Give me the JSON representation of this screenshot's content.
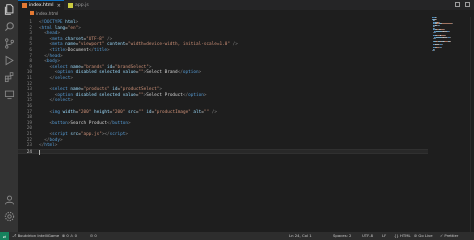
{
  "tabs": [
    {
      "label": "index.html",
      "active": true
    },
    {
      "label": "app.js",
      "active": false
    }
  ],
  "breadcrumb": {
    "file": "index.html"
  },
  "editor": {
    "current_line": 24,
    "lines": [
      {
        "n": "1",
        "segs": [
          [
            "punct",
            "<"
          ],
          [
            "tag",
            "!DOCTYPE"
          ],
          [
            "attr",
            " html"
          ],
          [
            "punct",
            ">"
          ]
        ]
      },
      {
        "n": "2",
        "segs": [
          [
            "punct",
            "<"
          ],
          [
            "tag",
            "html"
          ],
          [
            "attr",
            " lang"
          ],
          [
            "txt",
            "="
          ],
          [
            "str",
            "\"en\""
          ],
          [
            "punct",
            ">"
          ]
        ]
      },
      {
        "n": "3",
        "segs": [
          [
            "txt",
            "  "
          ],
          [
            "punct",
            "<"
          ],
          [
            "tag",
            "head"
          ],
          [
            "punct",
            ">"
          ]
        ]
      },
      {
        "n": "4",
        "segs": [
          [
            "txt",
            "    "
          ],
          [
            "punct",
            "<"
          ],
          [
            "tag",
            "meta"
          ],
          [
            "attr",
            " charset"
          ],
          [
            "txt",
            "="
          ],
          [
            "str",
            "\"UTF-8\""
          ],
          [
            "punct",
            " />"
          ]
        ]
      },
      {
        "n": "5",
        "segs": [
          [
            "txt",
            "    "
          ],
          [
            "punct",
            "<"
          ],
          [
            "tag",
            "meta"
          ],
          [
            "attr",
            " name"
          ],
          [
            "txt",
            "="
          ],
          [
            "str",
            "\"viewport\""
          ],
          [
            "attr",
            " content"
          ],
          [
            "txt",
            "="
          ],
          [
            "str",
            "\"width=device-width, initial-scale=1.0\""
          ],
          [
            "punct",
            " />"
          ]
        ]
      },
      {
        "n": "6",
        "segs": [
          [
            "txt",
            "    "
          ],
          [
            "punct",
            "<"
          ],
          [
            "tag",
            "title"
          ],
          [
            "punct",
            ">"
          ],
          [
            "txt",
            "Document"
          ],
          [
            "punct",
            "</"
          ],
          [
            "tag",
            "title"
          ],
          [
            "punct",
            ">"
          ]
        ]
      },
      {
        "n": "7",
        "segs": [
          [
            "txt",
            "  "
          ],
          [
            "punct",
            "</"
          ],
          [
            "tag",
            "head"
          ],
          [
            "punct",
            ">"
          ]
        ]
      },
      {
        "n": "8",
        "segs": [
          [
            "txt",
            "  "
          ],
          [
            "punct",
            "<"
          ],
          [
            "tag",
            "body"
          ],
          [
            "punct",
            ">"
          ]
        ]
      },
      {
        "n": "9",
        "segs": [
          [
            "txt",
            "    "
          ],
          [
            "punct",
            "<"
          ],
          [
            "tag",
            "select"
          ],
          [
            "attr",
            " name"
          ],
          [
            "txt",
            "="
          ],
          [
            "str",
            "\"brands\""
          ],
          [
            "attr",
            " id"
          ],
          [
            "txt",
            "="
          ],
          [
            "str",
            "\"brandSelect\""
          ],
          [
            "punct",
            ">"
          ]
        ]
      },
      {
        "n": "10",
        "segs": [
          [
            "txt",
            "      "
          ],
          [
            "punct",
            "<"
          ],
          [
            "tag",
            "option"
          ],
          [
            "attr",
            " disabled selected value"
          ],
          [
            "txt",
            "="
          ],
          [
            "str",
            "\"\""
          ],
          [
            "punct",
            ">"
          ],
          [
            "txt",
            "Select Brand"
          ],
          [
            "punct",
            "</"
          ],
          [
            "tag",
            "option"
          ],
          [
            "punct",
            ">"
          ]
        ]
      },
      {
        "n": "11",
        "segs": [
          [
            "txt",
            "    "
          ],
          [
            "punct",
            "</"
          ],
          [
            "tag",
            "select"
          ],
          [
            "punct",
            ">"
          ]
        ]
      },
      {
        "n": "12",
        "segs": []
      },
      {
        "n": "13",
        "segs": [
          [
            "txt",
            "    "
          ],
          [
            "punct",
            "<"
          ],
          [
            "tag",
            "select"
          ],
          [
            "attr",
            " name"
          ],
          [
            "txt",
            "="
          ],
          [
            "str",
            "\"products\""
          ],
          [
            "attr",
            " id"
          ],
          [
            "txt",
            "="
          ],
          [
            "str",
            "\"productSelect\""
          ],
          [
            "punct",
            ">"
          ]
        ]
      },
      {
        "n": "14",
        "segs": [
          [
            "txt",
            "      "
          ],
          [
            "punct",
            "<"
          ],
          [
            "tag",
            "option"
          ],
          [
            "attr",
            " disabled selected value"
          ],
          [
            "txt",
            "="
          ],
          [
            "str",
            "\"\""
          ],
          [
            "punct",
            ">"
          ],
          [
            "txt",
            "Select Product"
          ],
          [
            "punct",
            "</"
          ],
          [
            "tag",
            "option"
          ],
          [
            "punct",
            ">"
          ]
        ]
      },
      {
        "n": "15",
        "segs": [
          [
            "txt",
            "    "
          ],
          [
            "punct",
            "</"
          ],
          [
            "tag",
            "select"
          ],
          [
            "punct",
            ">"
          ]
        ]
      },
      {
        "n": "16",
        "segs": []
      },
      {
        "n": "17",
        "segs": [
          [
            "txt",
            "    "
          ],
          [
            "punct",
            "<"
          ],
          [
            "tag",
            "img"
          ],
          [
            "attr",
            " width"
          ],
          [
            "txt",
            "="
          ],
          [
            "str",
            "\"200\""
          ],
          [
            "attr",
            " height"
          ],
          [
            "txt",
            "="
          ],
          [
            "str",
            "\"200\""
          ],
          [
            "attr",
            " src"
          ],
          [
            "txt",
            "="
          ],
          [
            "str",
            "\"\""
          ],
          [
            "attr",
            " id"
          ],
          [
            "txt",
            "="
          ],
          [
            "str",
            "\"productImage\""
          ],
          [
            "attr",
            " alt"
          ],
          [
            "txt",
            "="
          ],
          [
            "str",
            "\"\""
          ],
          [
            "punct",
            " />"
          ]
        ]
      },
      {
        "n": "18",
        "segs": []
      },
      {
        "n": "19",
        "segs": [
          [
            "txt",
            "    "
          ],
          [
            "punct",
            "<"
          ],
          [
            "tag",
            "button"
          ],
          [
            "punct",
            ">"
          ],
          [
            "txt",
            "Search Product"
          ],
          [
            "punct",
            "</"
          ],
          [
            "tag",
            "button"
          ],
          [
            "punct",
            ">"
          ]
        ]
      },
      {
        "n": "20",
        "segs": []
      },
      {
        "n": "21",
        "segs": [
          [
            "txt",
            "    "
          ],
          [
            "punct",
            "<"
          ],
          [
            "tag",
            "script"
          ],
          [
            "attr",
            " src"
          ],
          [
            "txt",
            "="
          ],
          [
            "str",
            "\"app.js\""
          ],
          [
            "punct",
            "></"
          ],
          [
            "tag",
            "script"
          ],
          [
            "punct",
            ">"
          ]
        ]
      },
      {
        "n": "22",
        "segs": [
          [
            "txt",
            "  "
          ],
          [
            "punct",
            "</"
          ],
          [
            "tag",
            "body"
          ],
          [
            "punct",
            ">"
          ]
        ]
      },
      {
        "n": "23",
        "segs": [
          [
            "punct",
            "</"
          ],
          [
            "tag",
            "html"
          ],
          [
            "punct",
            ">"
          ]
        ]
      },
      {
        "n": "24",
        "segs": []
      }
    ]
  },
  "statusbar": {
    "left": [
      {
        "icon": "branch-icon",
        "text": "⎇ Boutdrion IntelliGame"
      },
      {
        "icon": "error-icon",
        "text": "⊗ 0 ⚠ 0"
      },
      {
        "icon": "port-icon",
        "text": "⊙ 0"
      }
    ],
    "right": [
      {
        "text": "Ln 24, Col 1"
      },
      {
        "text": "Spaces: 2"
      },
      {
        "text": "UTF-8"
      },
      {
        "text": "LF"
      },
      {
        "text": "{} HTML"
      },
      {
        "text": "⊘ Go Live"
      },
      {
        "text": "✓ Prettier"
      }
    ]
  },
  "colors": {
    "tag": "#569cd6",
    "attr": "#9cdcfe",
    "string": "#ce9178",
    "punct": "#808080",
    "text": "#d4d4d4",
    "editor_bg": "#1e1e1e",
    "statusbar_bg": "#2d2d2d",
    "remote_bg": "#16825d"
  },
  "activity_icons": [
    "files-icon",
    "search-icon",
    "source-control-icon",
    "run-debug-icon",
    "extensions-icon",
    "remote-explorer-icon",
    "account-icon",
    "settings-gear-icon"
  ]
}
